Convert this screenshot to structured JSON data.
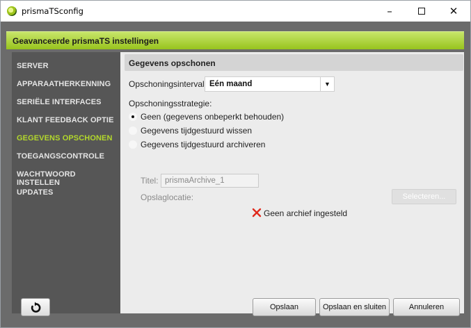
{
  "window": {
    "title": "prismaTSconfig",
    "minimize_label": "–",
    "close_label": "✕"
  },
  "header": {
    "title": "Geavanceerde prismaTS instellingen"
  },
  "sidebar": {
    "items": [
      {
        "label": "SERVER",
        "active": false
      },
      {
        "label": "APPARAATHERKENNING",
        "active": false
      },
      {
        "label": "SERIËLE INTERFACES",
        "active": false
      },
      {
        "label": "KLANT FEEDBACK OPTIE",
        "active": false
      },
      {
        "label": "GEGEVENS OPSCHONEN",
        "active": true
      },
      {
        "label": "TOEGANGSCONTROLE",
        "active": false
      },
      {
        "label": "WACHTWOORD INSTELLEN",
        "active": false
      },
      {
        "label": "UPDATES",
        "active": false
      }
    ]
  },
  "main": {
    "section_title": "Gegevens opschonen",
    "interval_label": "Opschoningsinterval:",
    "interval_value": "Eén maand",
    "strategy_label": "Opschoningsstrategie:",
    "strategies": [
      {
        "label": "Geen (gegevens onbeperkt behouden)",
        "checked": true
      },
      {
        "label": "Gegevens tijdgestuurd wissen",
        "checked": false
      },
      {
        "label": "Gegevens tijdgestuurd archiveren",
        "checked": false
      }
    ],
    "title_label": "Titel:",
    "title_value": "prismaArchive_1",
    "location_label": "Opslaglocatie:",
    "select_button": "Selecteren...",
    "status_text": "Geen archief ingesteld"
  },
  "footer": {
    "save": "Opslaan",
    "save_close": "Opslaan en sluiten",
    "cancel": "Annuleren"
  },
  "colors": {
    "accent_green": "#98c41d",
    "active_nav": "#b3d82c",
    "error_red": "#e0291c"
  }
}
